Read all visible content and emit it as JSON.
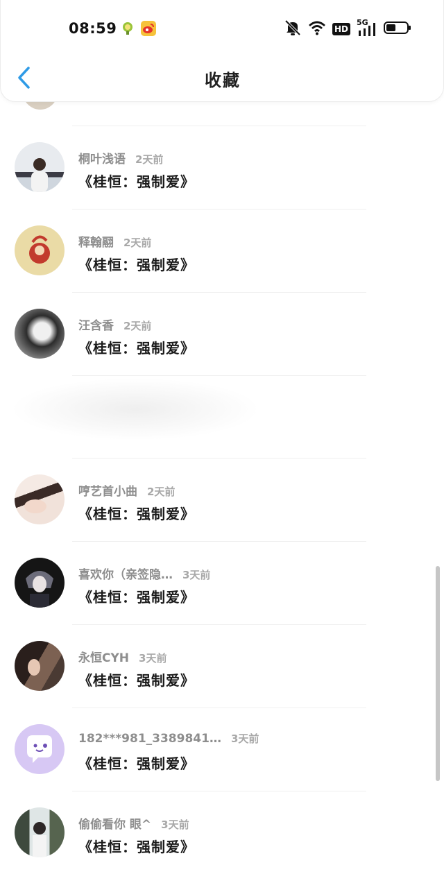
{
  "status_bar": {
    "time": "08:59",
    "network_label": "5G",
    "hd_label": "HD"
  },
  "header": {
    "title": "收藏"
  },
  "items": [
    {
      "user": "桐叶浅语",
      "ago": "2天前",
      "work": "《桂恒：强制爱》"
    },
    {
      "user": "释翰翮",
      "ago": "2天前",
      "work": "《桂恒：强制爱》"
    },
    {
      "user": "汪含香",
      "ago": "2天前",
      "work": "《桂恒：强制爱》"
    },
    {
      "user": "哼艺首小曲",
      "ago": "2天前",
      "work": "《桂恒：强制爱》"
    },
    {
      "user": "喜欢你（亲签隐…",
      "ago": "3天前",
      "work": "《桂恒：强制爱》"
    },
    {
      "user": "永恒CYH",
      "ago": "3天前",
      "work": "《桂恒：强制爱》"
    },
    {
      "user": "182***981_3389841…",
      "ago": "3天前",
      "work": "《桂恒：强制爱》"
    },
    {
      "user": "偷偷看你  眼^",
      "ago": "3天前",
      "work": "《桂恒：强制爱》"
    }
  ],
  "colors": {
    "accent": "#2f9be6",
    "avatar_default": "#d7c8f4"
  }
}
